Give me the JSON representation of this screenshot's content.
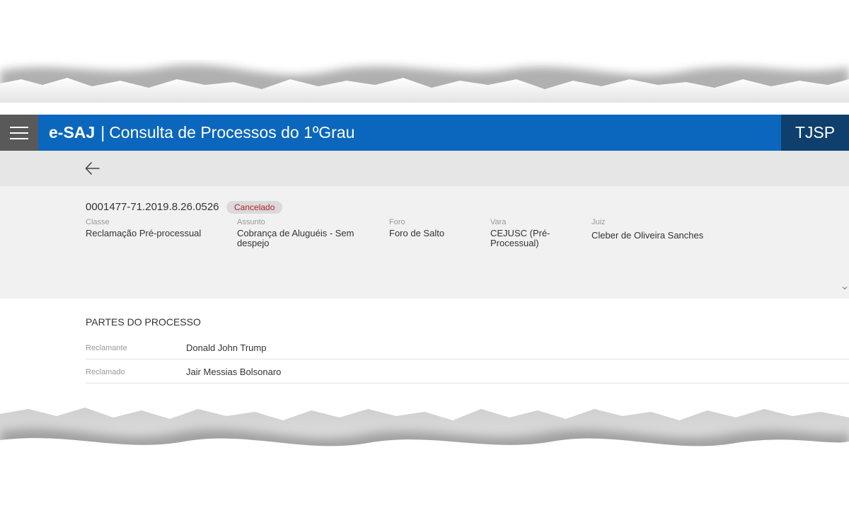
{
  "header": {
    "brand": "e-SAJ",
    "separator": "|",
    "title": "Consulta de Processos do 1ºGrau",
    "court": "TJSP"
  },
  "icons": {
    "menu": "hamburger-menu-icon",
    "back": "arrow-left-icon",
    "collapse": "chevron-down-icon"
  },
  "process": {
    "number": "0001477-71.2019.8.26.0526",
    "status": "Cancelado",
    "fields": [
      {
        "label": "Classe",
        "value": "Reclamação Pré-processual"
      },
      {
        "label": "Assunto",
        "value": "Cobrança de Aluguéis - Sem despejo"
      },
      {
        "label": "Foro",
        "value": "Foro de Salto"
      },
      {
        "label": "Vara",
        "value": "CEJUSC (Pré-Processual)"
      },
      {
        "label": "Juiz",
        "value": "Cleber de Oliveira Sanches"
      }
    ]
  },
  "parties": {
    "title": "PARTES DO PROCESSO",
    "rows": [
      {
        "role": "Reclamante",
        "name": "Donald John Trump"
      },
      {
        "role": "Reclamado",
        "name": "Jair Messias Bolsonaro"
      }
    ]
  },
  "colors": {
    "header": "#0a67bd",
    "court_box": "#0e3f6d",
    "menu_box": "#595959",
    "status_text": "#b1222a"
  }
}
